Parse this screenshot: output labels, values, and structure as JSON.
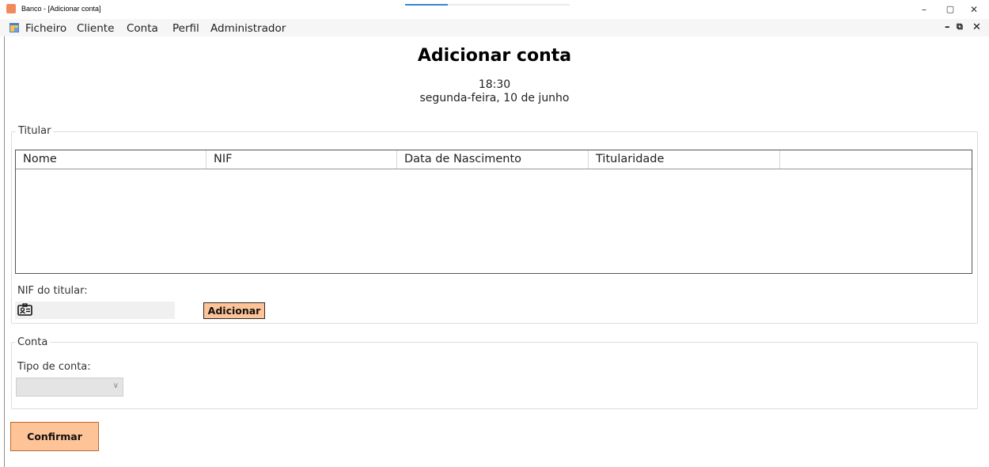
{
  "window": {
    "title": "Banco - [Adicionar conta]",
    "controls": {
      "minimize": "–",
      "maximize": "▢",
      "close": "✕"
    }
  },
  "menu": {
    "items": [
      "Ficheiro",
      "Cliente",
      "Conta",
      "Perfil",
      "Administrador"
    ],
    "mdi_controls": {
      "minimize": "–",
      "restore": "⧉",
      "close": "✕"
    }
  },
  "header": {
    "title": "Adicionar conta",
    "time": "18:30",
    "date": "segunda-feira, 10 de junho"
  },
  "titular": {
    "legend": "Titular",
    "columns": [
      "Nome",
      "NIF",
      "Data de Nascimento",
      "Titularidade"
    ],
    "rows": [],
    "nif_label": "NIF do titular:",
    "nif_value": "",
    "add_button": "Adicionar"
  },
  "conta": {
    "legend": "Conta",
    "tipo_label": "Tipo de conta:",
    "tipo_value": ""
  },
  "actions": {
    "confirm_button": "Confirmar"
  },
  "colors": {
    "button_fill": "#fec397",
    "progress_accent": "#3b84d6"
  }
}
